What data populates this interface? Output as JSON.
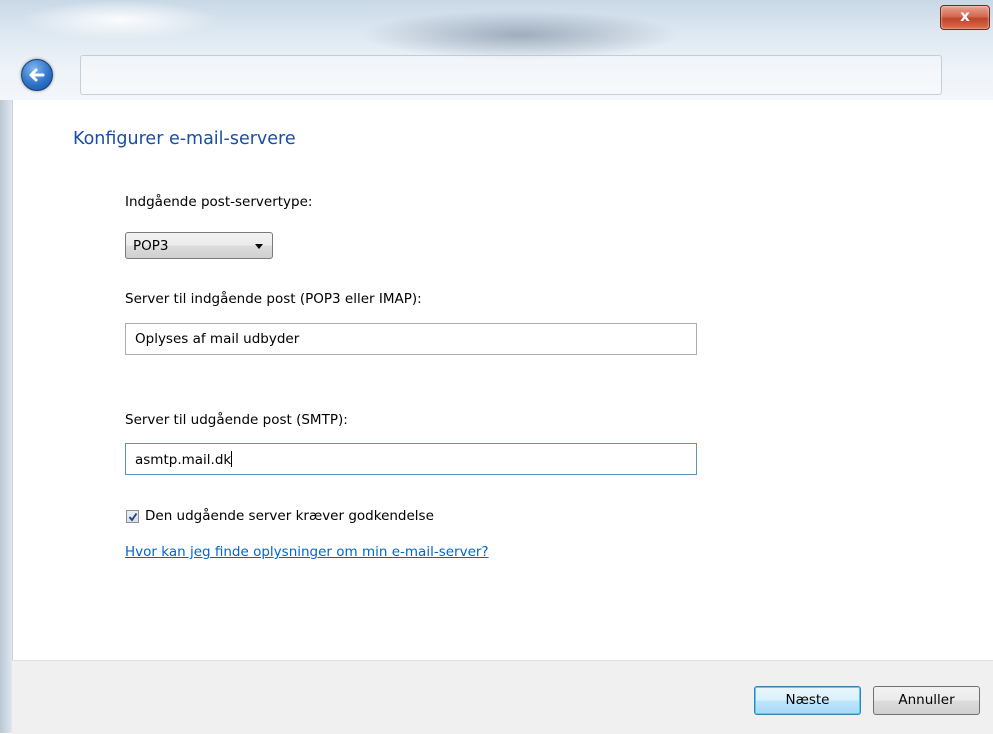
{
  "window": {
    "close_label": "x"
  },
  "page": {
    "title": "Konfigurer e-mail-servere"
  },
  "incoming_type": {
    "label": "Indgående post-servertype:",
    "selected": "POP3"
  },
  "incoming_server": {
    "label": "Server til indgående post (POP3 eller IMAP):",
    "value": "Oplyses af mail udbyder"
  },
  "outgoing_server": {
    "label": "Server til udgående post (SMTP):",
    "value": "asmtp.mail.dk"
  },
  "auth_checkbox": {
    "label": "Den udgående server kræver godkendelse",
    "checked": true
  },
  "help_link": {
    "text": "Hvor kan jeg finde oplysninger om min e-mail-server?"
  },
  "footer": {
    "next_label": "Næste",
    "cancel_label": "Annuller"
  }
}
